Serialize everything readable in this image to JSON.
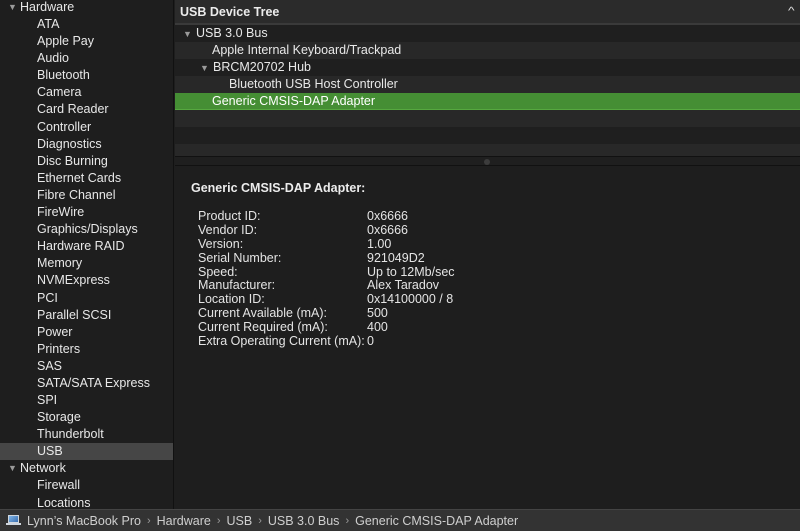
{
  "sidebar": {
    "groups": [
      {
        "label": "Hardware",
        "expanded": true,
        "items": [
          "ATA",
          "Apple Pay",
          "Audio",
          "Bluetooth",
          "Camera",
          "Card Reader",
          "Controller",
          "Diagnostics",
          "Disc Burning",
          "Ethernet Cards",
          "Fibre Channel",
          "FireWire",
          "Graphics/Displays",
          "Hardware RAID",
          "Memory",
          "NVMExpress",
          "PCI",
          "Parallel SCSI",
          "Power",
          "Printers",
          "SAS",
          "SATA/SATA Express",
          "SPI",
          "Storage",
          "Thunderbolt",
          "USB"
        ]
      },
      {
        "label": "Network",
        "expanded": true,
        "items": [
          "Firewall",
          "Locations"
        ]
      }
    ],
    "selected": "USB"
  },
  "tree": {
    "title": "USB Device Tree",
    "sort_icon": "chevron-up-icon",
    "rows": [
      {
        "label": "USB 3.0 Bus",
        "level": 0,
        "expandable": true,
        "expanded": true
      },
      {
        "label": "Apple Internal Keyboard/Trackpad",
        "level": 1,
        "expandable": false
      },
      {
        "label": "BRCM20702 Hub",
        "level": 1,
        "expandable": true,
        "expanded": true
      },
      {
        "label": "Bluetooth USB Host Controller",
        "level": 2,
        "expandable": false
      },
      {
        "label": "Generic CMSIS-DAP Adapter",
        "level": 1,
        "expandable": false,
        "selected": true
      }
    ],
    "selection_color": "#458e34"
  },
  "detail": {
    "heading": "Generic CMSIS-DAP Adapter:",
    "properties": [
      {
        "key": "Product ID:",
        "value": "0x6666"
      },
      {
        "key": "Vendor ID:",
        "value": "0x6666"
      },
      {
        "key": "Version:",
        "value": "1.00"
      },
      {
        "key": "Serial Number:",
        "value": "921049D2"
      },
      {
        "key": "Speed:",
        "value": "Up to 12Mb/sec"
      },
      {
        "key": "Manufacturer:",
        "value": "Alex Taradov"
      },
      {
        "key": "Location ID:",
        "value": "0x14100000 / 8"
      },
      {
        "key": "Current Available (mA):",
        "value": "500"
      },
      {
        "key": "Current Required (mA):",
        "value": "400"
      },
      {
        "key": "Extra Operating Current (mA):",
        "value": "0"
      }
    ]
  },
  "pathbar": {
    "icon": "laptop-icon",
    "crumbs": [
      "Lynn’s MacBook Pro",
      "Hardware",
      "USB",
      "USB 3.0 Bus",
      "Generic CMSIS-DAP Adapter"
    ],
    "separator": "›"
  }
}
